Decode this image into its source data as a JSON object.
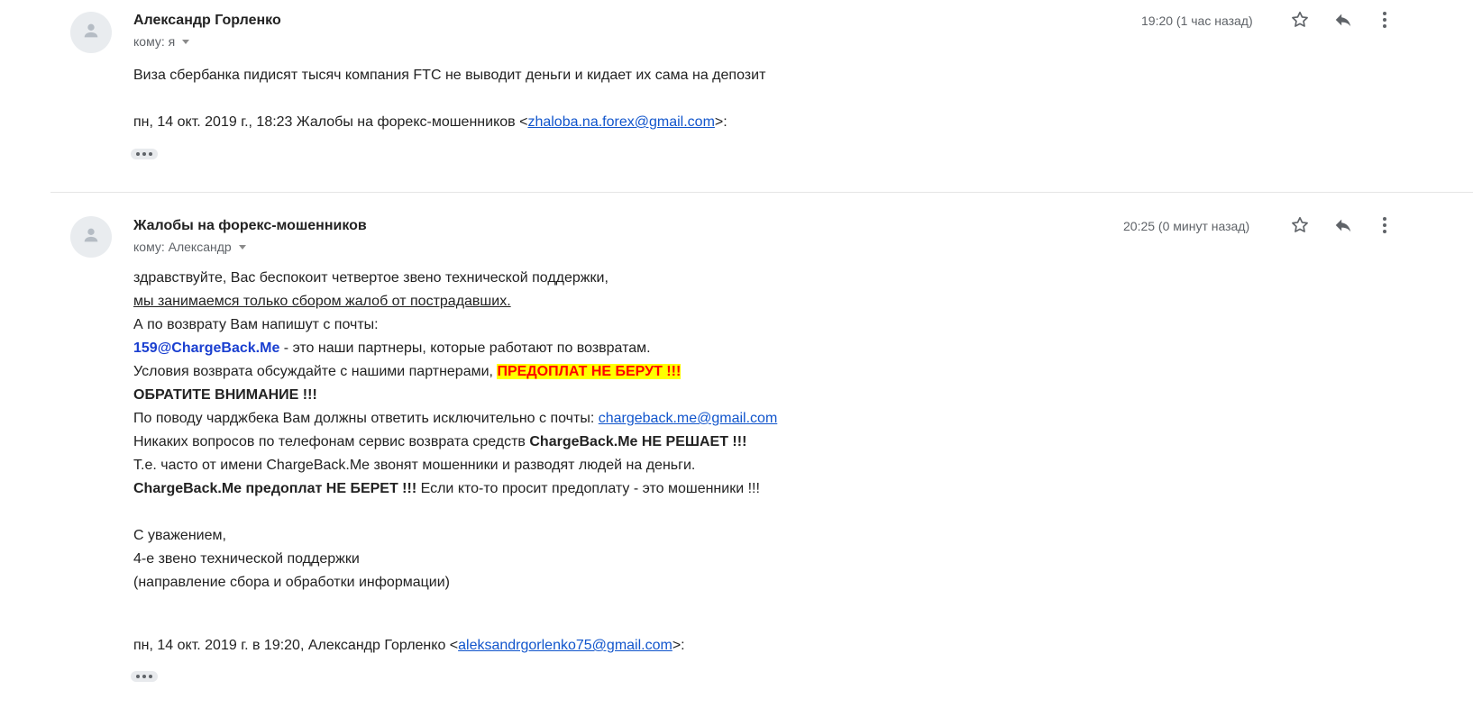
{
  "messages": [
    {
      "sender": "Александр Горленко",
      "to": "кому: я",
      "time": "19:20 (1 час назад)",
      "body": "Виза сбербанка пидисят тысяч компания FTC не выводит деньги и кидает их сама на депозит",
      "quote_prefix": "пн, 14 окт. 2019 г., 18:23 Жалобы на форекс-мошенников <",
      "quote_email": "zhaloba.na.forex@gmail.com",
      "quote_suffix": ">:"
    },
    {
      "sender": "Жалобы на форекс-мошенников",
      "to": "кому: Александр",
      "time": "20:25 (0 минут назад)",
      "lines": {
        "l1": "здравствуйте, Вас беспокоит четвертое звено технической поддержки,",
        "l2": "мы занимаемся только сбором жалоб от пострадавших.",
        "l3": "А по возврату Вам напишут с почты:",
        "l4_email": "159@ChargeBack.Me",
        "l4_rest": " - это наши партнеры, которые работают по возвратам.",
        "l5_text": "Условия возврата обсуждайте с нашими партнерами, ",
        "l5_highlight": "ПРЕДОПЛАТ НЕ БЕРУТ !!!",
        "l6": "ОБРАТИТЕ ВНИМАНИЕ !!!",
        "l7_text": "По поводу чарджбека Вам должны ответить исключительно с почты: ",
        "l7_email": "chargeback.me@gmail.com",
        "l8_text": "Никаких вопросов по телефонам сервис возврата средств ",
        "l8_bold": "ChargeBack.Me НЕ РЕШАЕТ !!!",
        "l9": "Т.е. часто от имени ChargeBack.Me звонят мошенники и разводят людей на деньги.",
        "l10_bold": "ChargeBack.Me предоплат НЕ БЕРЕТ !!!",
        "l10_rest": " Если кто-то просит предоплату - это мошенники !!!",
        "sig1": "С уважением,",
        "sig2": "4-е звено технической поддержки",
        "sig3": "(направление сбора и обработки информации)"
      },
      "quote_prefix": "пн, 14 окт. 2019 г. в 19:20, Александр Горленко <",
      "quote_email": "aleksandrgorlenko75@gmail.com",
      "quote_suffix": ">:"
    }
  ],
  "icons": {
    "avatar": "person-icon",
    "star": "star-icon",
    "reply": "reply-icon",
    "more": "more-vert-icon",
    "show_trimmed": "ellipsis-icon"
  },
  "colors": {
    "link": "#1155cc",
    "partner_email": "#1a3fd0",
    "highlight_bg": "#ffff00",
    "highlight_text": "#ff0000"
  }
}
